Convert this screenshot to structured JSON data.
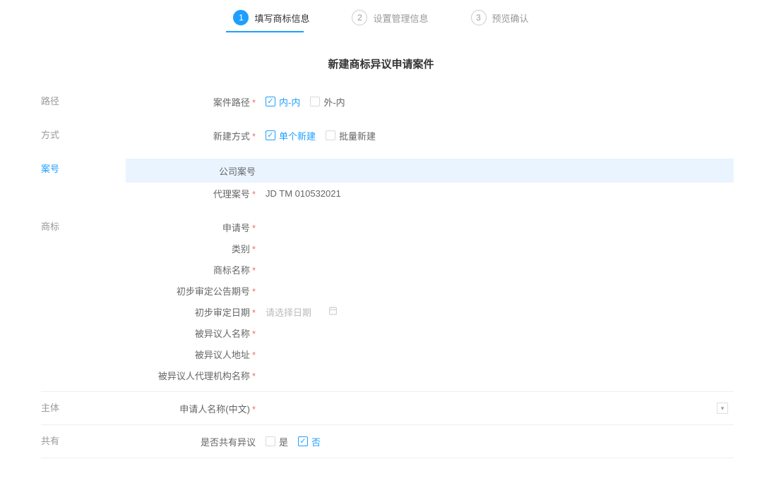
{
  "stepper": {
    "steps": [
      {
        "num": "1",
        "label": "填写商标信息"
      },
      {
        "num": "2",
        "label": "设置管理信息"
      },
      {
        "num": "3",
        "label": "预览确认"
      }
    ]
  },
  "page_title": "新建商标异议申请案件",
  "sections": {
    "path": {
      "label": "路径",
      "field_label": "案件路径",
      "opt_inner": "内-内",
      "opt_outer": "外-内"
    },
    "method": {
      "label": "方式",
      "field_label": "新建方式",
      "opt_single": "单个新建",
      "opt_batch": "批量新建"
    },
    "case_no": {
      "label": "案号",
      "company_label": "公司案号",
      "agent_label": "代理案号",
      "agent_value": "JD TM 010532021"
    },
    "trademark": {
      "label": "商标",
      "app_no": "申请号",
      "category": "类别",
      "tm_name": "商标名称",
      "prelim_pub_no": "初步审定公告期号",
      "prelim_date": "初步审定日期",
      "prelim_date_placeholder": "请选择日期",
      "opposed_name": "被异议人名称",
      "opposed_addr": "被异议人地址",
      "opposed_agent": "被异议人代理机构名称"
    },
    "subject": {
      "label": "主体",
      "applicant_cn": "申请人名称(中文)"
    },
    "joint": {
      "label": "共有",
      "is_joint": "是否共有异议",
      "yes": "是",
      "no": "否"
    }
  }
}
